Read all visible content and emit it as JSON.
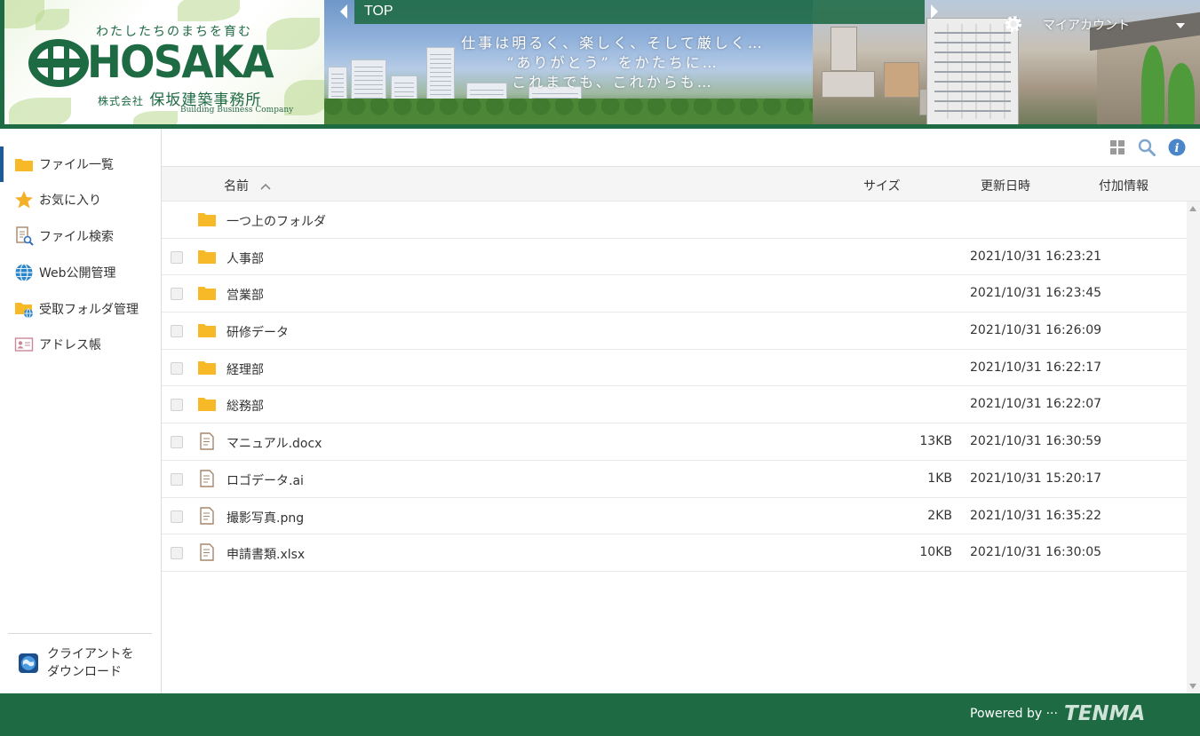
{
  "brand": {
    "tagline": "わたしたちのまちを育む",
    "name": "HOSAKA",
    "company_prefix": "株式会社",
    "company_name": "保坂建築事務所",
    "company_en": "Building Business Company"
  },
  "banner": {
    "caption_lines": [
      "仕事は明るく、楽しく、そして厳しく…",
      "“ありがとう” をかたちに…",
      "これまでも、これからも…"
    ]
  },
  "breadcrumb": {
    "label": "TOP"
  },
  "account": {
    "label": "マイアカウント"
  },
  "sidebar": {
    "items": [
      {
        "label": "ファイル一覧",
        "icon": "folder-icon",
        "active": true
      },
      {
        "label": "お気に入り",
        "icon": "star-icon"
      },
      {
        "label": "ファイル検索",
        "icon": "file-search-icon"
      },
      {
        "label": "Web公開管理",
        "icon": "globe-icon"
      },
      {
        "label": "受取フォルダ管理",
        "icon": "receive-folder-icon"
      },
      {
        "label": "アドレス帳",
        "icon": "address-book-icon"
      }
    ],
    "client_download": "クライアントを\nダウンロード"
  },
  "toolbar": {
    "icons": [
      "grid-view-icon",
      "search-icon",
      "info-icon"
    ]
  },
  "columns": {
    "name": "名前",
    "size": "サイズ",
    "updated": "更新日時",
    "extra": "付加情報"
  },
  "rows": [
    {
      "type": "parent",
      "name": "一つ上のフォルダ",
      "size": "",
      "updated": ""
    },
    {
      "type": "folder",
      "name": "人事部",
      "size": "",
      "updated": "2021/10/31 16:23:21"
    },
    {
      "type": "folder",
      "name": "営業部",
      "size": "",
      "updated": "2021/10/31 16:23:45"
    },
    {
      "type": "folder",
      "name": "研修データ",
      "size": "",
      "updated": "2021/10/31 16:26:09"
    },
    {
      "type": "folder",
      "name": "経理部",
      "size": "",
      "updated": "2021/10/31 16:22:17"
    },
    {
      "type": "folder",
      "name": "総務部",
      "size": "",
      "updated": "2021/10/31 16:22:07"
    },
    {
      "type": "file",
      "name": "マニュアル.docx",
      "size": "13KB",
      "updated": "2021/10/31 16:30:59"
    },
    {
      "type": "file",
      "name": "ロゴデータ.ai",
      "size": "1KB",
      "updated": "2021/10/31 15:20:17"
    },
    {
      "type": "file",
      "name": "撮影写真.png",
      "size": "2KB",
      "updated": "2021/10/31 16:35:22"
    },
    {
      "type": "file",
      "name": "申請書類.xlsx",
      "size": "10KB",
      "updated": "2021/10/31 16:30:05"
    }
  ],
  "footer": {
    "powered_by": "Powered by",
    "vendor": "TENMA"
  },
  "colors": {
    "brand_green": "#1e6a43",
    "folder_yellow": "#f7b928",
    "active_blue": "#1e5a96",
    "info_blue": "#4a86c8"
  }
}
